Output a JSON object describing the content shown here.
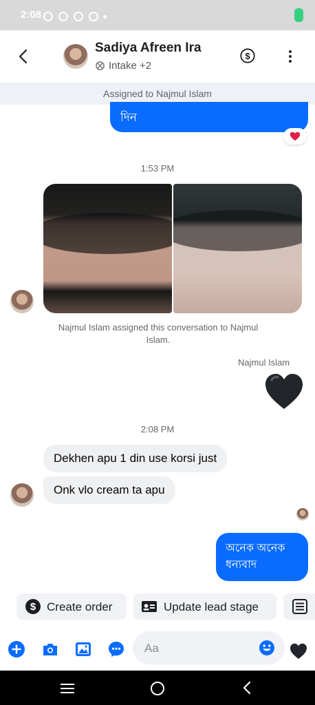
{
  "status_bar": {
    "time": "2:08"
  },
  "header": {
    "contact_name": "Sadiya Afreen Ira",
    "label": "Intake",
    "label_extra": "+2",
    "icons": [
      "back-icon",
      "dollar-icon",
      "more-icon"
    ]
  },
  "assigned_banner": "Assigned to Najmul Islam",
  "messages": {
    "top_outgoing": "দিন",
    "time_1": "1:53 PM",
    "assignment_note": "Najmul Islam assigned this conversation to Najmul Islam.",
    "sender_name": "Najmul Islam",
    "time_2": "2:08 PM",
    "incoming_1": "Dekhen apu 1 din use korsi just",
    "incoming_2": "Onk vlo cream ta apu",
    "outgoing_bengali": "অনেক অনেক ধন্যবাদ"
  },
  "quick_actions": {
    "create_order": "Create order",
    "update_lead_stage": "Update lead stage"
  },
  "composer": {
    "placeholder": "Aa",
    "value": ""
  },
  "colors": {
    "accent": "#0A6CFF",
    "incoming_bubble": "#EFF0F2",
    "reaction_heart": "#E11D48"
  }
}
